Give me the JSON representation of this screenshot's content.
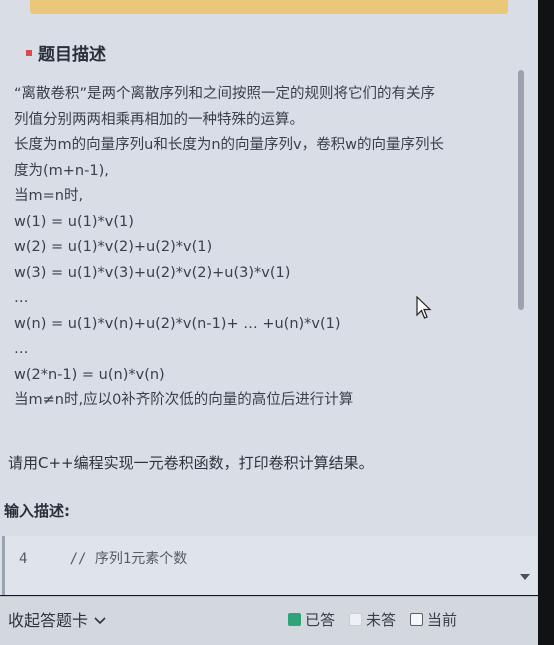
{
  "section_title": "题目描述",
  "description": [
    "“离散卷积”是两个离散序列和之间按照一定的规则将它们的有关序",
    "列值分别两两相乘再相加的一种特殊的运算。",
    "长度为m的向量序列u和长度为n的向量序列v，卷积w的向量序列长",
    "度为(m+n-1),",
    "当m=n时,",
    "w(1) = u(1)*v(1)",
    "w(2) = u(1)*v(2)+u(2)*v(1)",
    "w(3) = u(1)*v(3)+u(2)*v(2)+u(3)*v(1)",
    "…",
    "w(n) = u(1)*v(n)+u(2)*v(n-1)+ … +u(n)*v(1)",
    "…",
    "w(2*n-1) = u(n)*v(n)",
    "当m≠n时,应以0补齐阶次低的向量的高位后进行计算"
  ],
  "prompt": "请用C++编程实现一元卷积函数，打印卷积计算结果。",
  "input_title": "输入描述:",
  "code": {
    "line1": "4     // 序列1元素个数"
  },
  "bottom_bar": {
    "collapse_label": "收起答题卡",
    "legend": {
      "answered": "已答",
      "unanswered": "未答",
      "current": "当前"
    }
  },
  "colors": {
    "answered": "#2fa37a",
    "accent_bullet": "#d94a4a",
    "banner": "#e9c879"
  },
  "icons": {
    "collapse": "chevron-down-icon",
    "cursor": "mouse-pointer-icon"
  }
}
